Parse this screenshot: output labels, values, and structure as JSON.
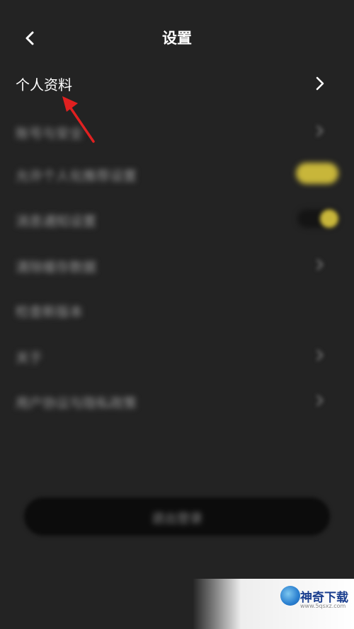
{
  "header": {
    "title": "设置",
    "back_icon": "chevron-left-icon"
  },
  "profile_row": {
    "label": "个人资料",
    "chevron_icon": "chevron-right-icon"
  },
  "blurred_rows": [
    {
      "label": "账号与安全",
      "control": "chevron"
    },
    {
      "label": "允许个人化推荐设置",
      "control": "toggle-on"
    },
    {
      "label": "消息通知设置",
      "control": "toggle-knob"
    },
    {
      "label": "清除缓存数据",
      "control": "chevron"
    },
    {
      "label": "检查新版本",
      "control": "none"
    },
    {
      "label": "关于",
      "control": "chevron"
    },
    {
      "label": "用户协议与隐私政策",
      "control": "chevron"
    }
  ],
  "logout": {
    "label": "退出登录"
  },
  "watermark": {
    "title": "神奇下载",
    "url": "www.5qsxz.com"
  },
  "colors": {
    "background": "#232323",
    "accent_yellow": "#c8b63a",
    "annotation_red": "#e02020",
    "text_primary": "#ffffff"
  }
}
